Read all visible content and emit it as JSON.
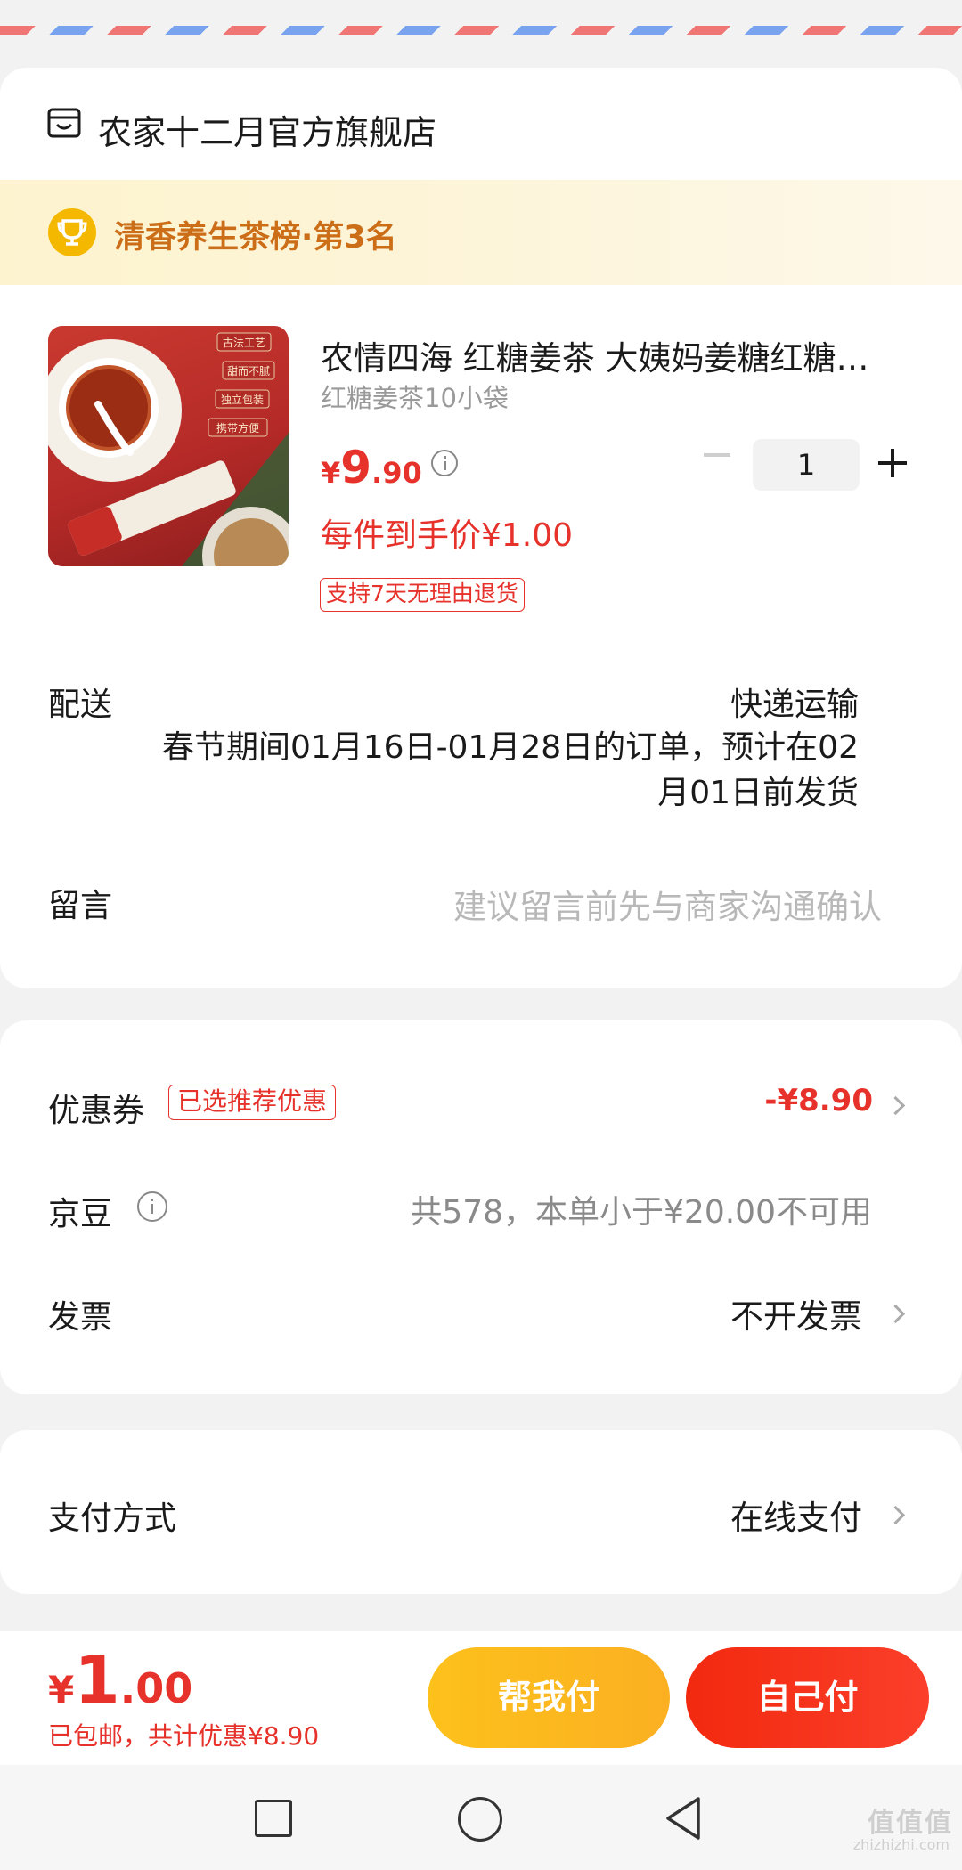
{
  "shop": {
    "icon": "shop-icon",
    "name": "农家十二月官方旗舰店"
  },
  "ranking": {
    "icon": "trophy-icon",
    "text": "清香养生茶榜·第3名"
  },
  "product": {
    "image_texts": [
      "古法工艺",
      "甜而不腻",
      "独立包装",
      "携带方便"
    ],
    "title": "农情四海 红糖姜茶 大姨妈姜糖红糖姜枣茶",
    "spec": "红糖姜茶10小袋",
    "price": {
      "currency": "¥",
      "integer": "9",
      "decimal": ".90"
    },
    "final_price": "每件到手价¥1.00",
    "return_policy": "支持7天无理由退货",
    "quantity": "1"
  },
  "shipping": {
    "label": "配送",
    "method": "快递运输",
    "note": "春节期间01月16日-01月28日的订单，预计在02月01日前发货"
  },
  "message": {
    "label": "留言",
    "placeholder": "建议留言前先与商家沟通确认"
  },
  "coupon": {
    "label": "优惠券",
    "tag": "已选推荐优惠",
    "value": "-¥8.90"
  },
  "beans": {
    "label": "京豆",
    "value": "共578，本单小于¥20.00不可用"
  },
  "invoice": {
    "label": "发票",
    "value": "不开发票"
  },
  "payment": {
    "label": "支付方式",
    "value": "在线支付"
  },
  "footer": {
    "total": {
      "currency": "¥",
      "integer": "1",
      "decimal": ".00"
    },
    "note": "已包邮，共计优惠¥8.90",
    "help_pay": "帮我付",
    "self_pay": "自己付"
  },
  "watermark": {
    "logo": "值值值",
    "site": "zhizhizhi.com"
  },
  "colors": {
    "accent": "#e6322b",
    "rank_text": "#cc6e18",
    "help_button": "#fdc11b",
    "self_button": "#f2290f"
  }
}
